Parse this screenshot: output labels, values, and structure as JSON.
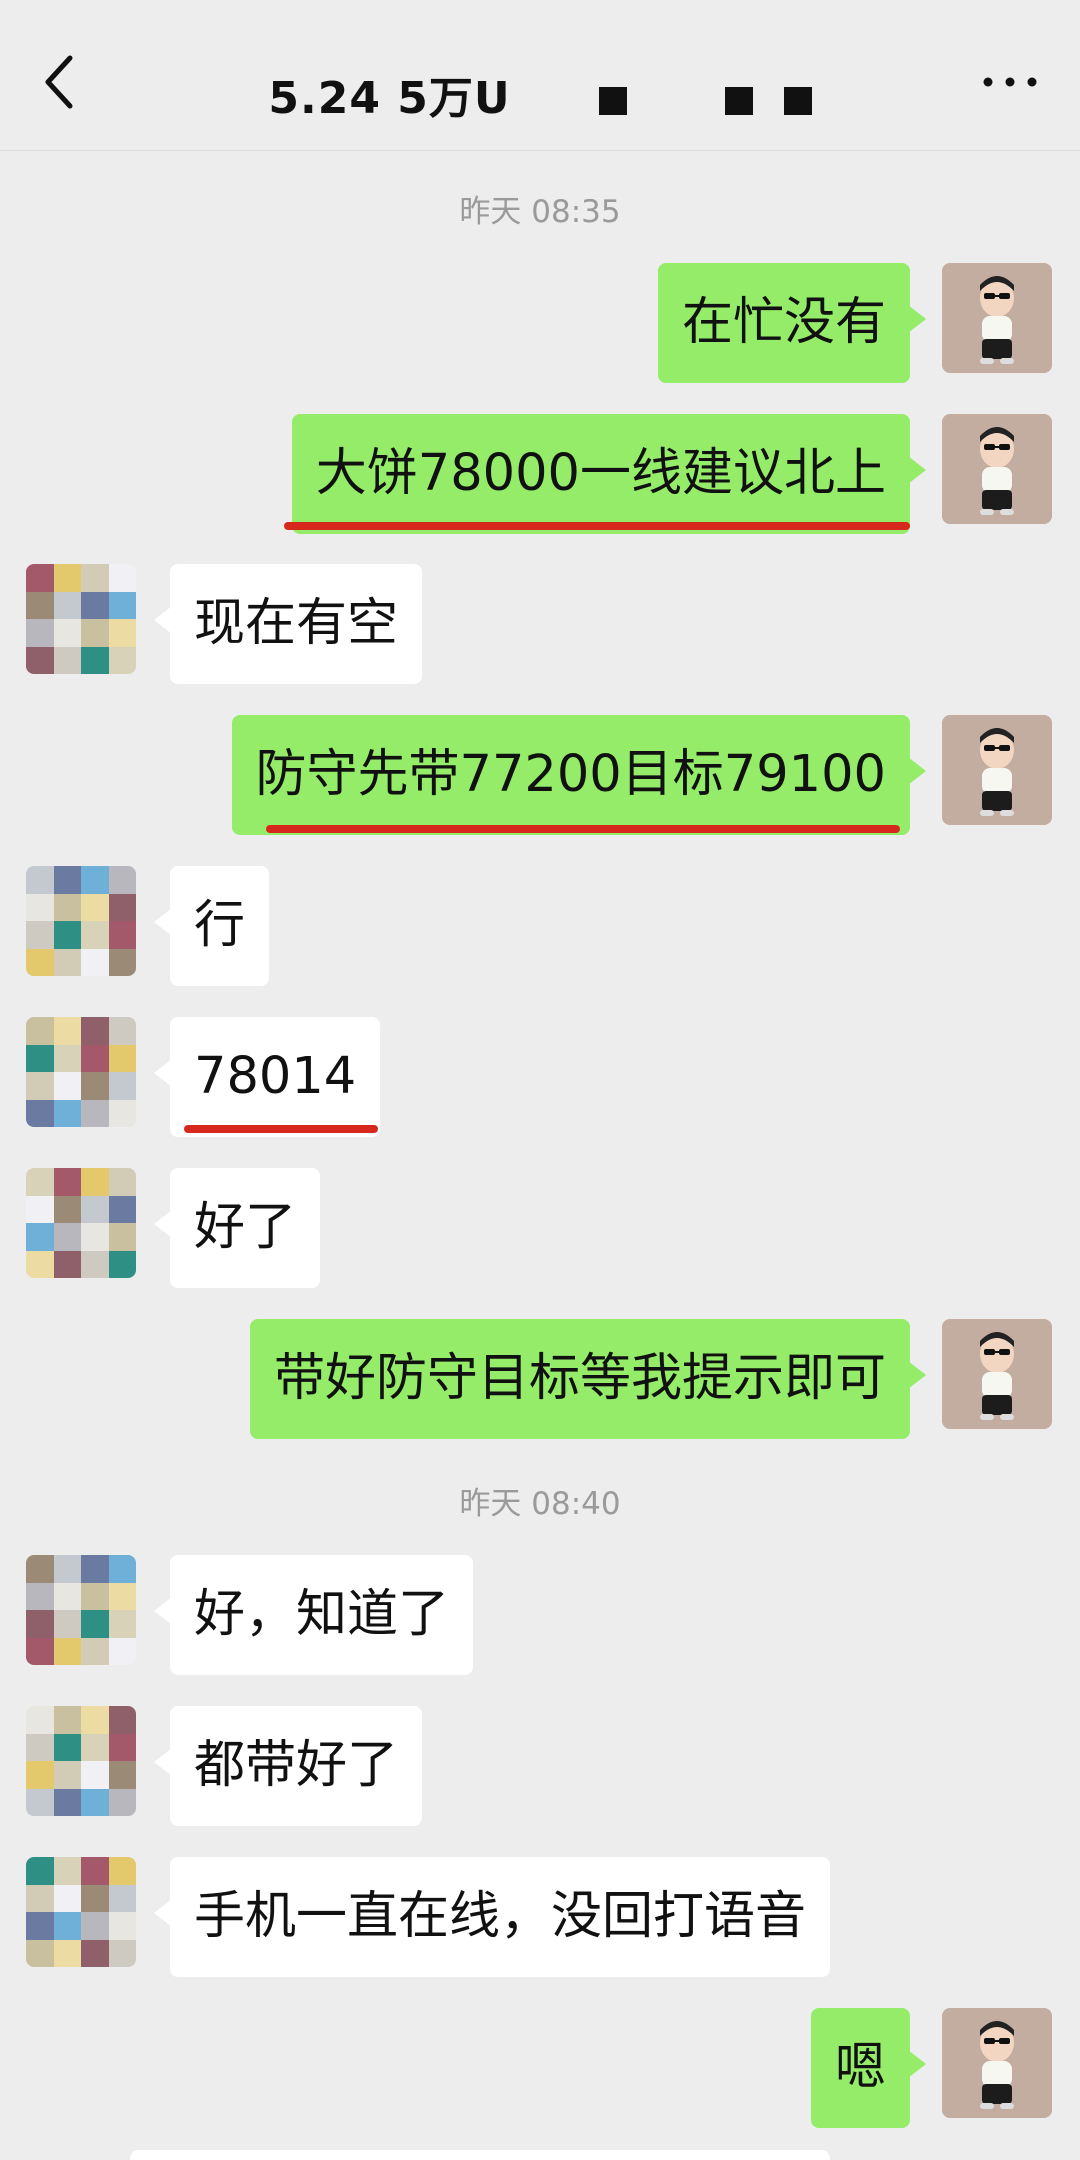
{
  "header": {
    "title": "5.24  5万U",
    "back_icon": "chevron-left-icon",
    "more_icon": "more-dots-icon"
  },
  "timestamps": [
    "昨天 08:35",
    "昨天 08:40"
  ],
  "messages": [
    {
      "side": "me",
      "text": "在忙没有"
    },
    {
      "side": "me",
      "text": "大饼78000一线建议北上",
      "underlined": true
    },
    {
      "side": "them",
      "text": "现在有空"
    },
    {
      "side": "me",
      "text": "防守先带77200目标79100",
      "underlined": true
    },
    {
      "side": "them",
      "text": "行"
    },
    {
      "side": "them",
      "text": "78014",
      "underlined": true
    },
    {
      "side": "them",
      "text": "好了"
    },
    {
      "side": "me",
      "text": "带好防守目标等我提示即可"
    },
    {
      "side": "them",
      "text": "好，知道了"
    },
    {
      "side": "them",
      "text": "都带好了"
    },
    {
      "side": "them",
      "text": "手机一直在线，没回打语音"
    },
    {
      "side": "me",
      "text": "嗯"
    }
  ],
  "colors": {
    "background": "#ededed",
    "my_bubble": "#95ec69",
    "their_bubble": "#ffffff",
    "highlight_underline": "#d6281c",
    "timestamp_text": "#9a9a9a"
  }
}
